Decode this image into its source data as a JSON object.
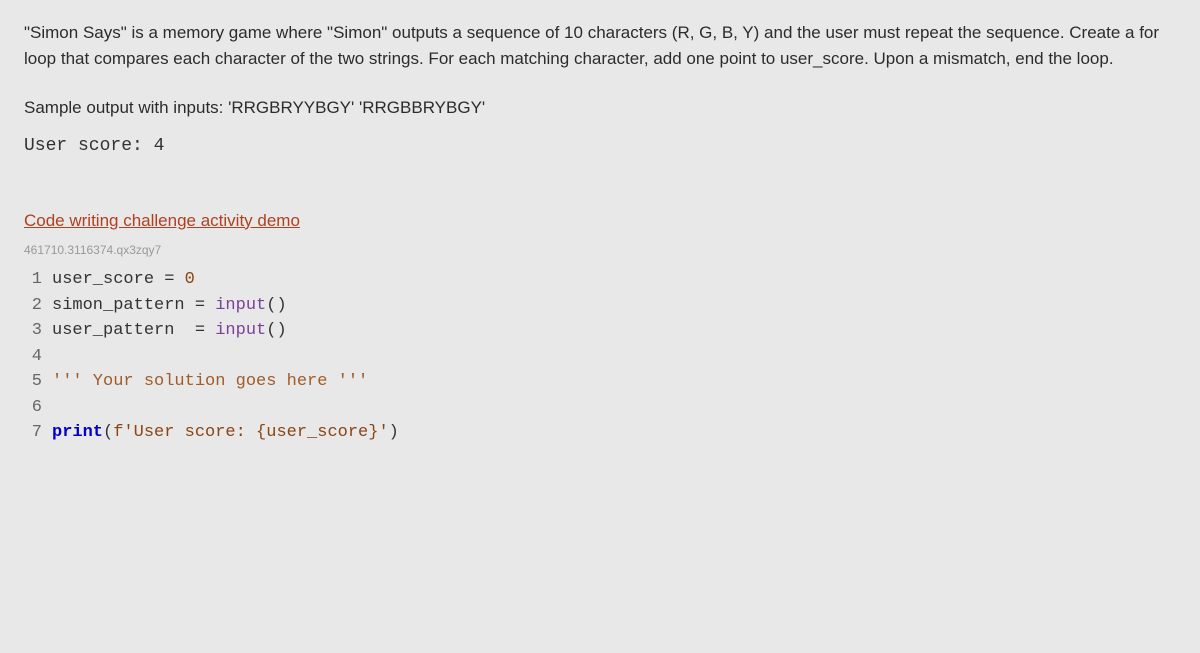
{
  "problem": {
    "description": "\"Simon Says\" is a memory game where \"Simon\" outputs a sequence of 10 characters (R, G, B, Y) and the user must repeat the sequence. Create a for loop that compares each character of the two strings. For each matching character, add one point to user_score. Upon a mismatch, end the loop.",
    "sample_label": "Sample output with inputs: 'RRGBRYYBGY' 'RRGBBRYBGY'",
    "sample_output": "User score: 4"
  },
  "demo_link": "Code writing challenge activity demo",
  "activity_id": "461710.3116374.qx3zqy7",
  "code": {
    "lines": [
      {
        "num": "1",
        "text": "user_score = 0"
      },
      {
        "num": "2",
        "text": "simon_pattern = input()"
      },
      {
        "num": "3",
        "text": "user_pattern  = input()"
      },
      {
        "num": "4",
        "text": ""
      },
      {
        "num": "5",
        "text": "''' Your solution goes here '''"
      },
      {
        "num": "6",
        "text": ""
      },
      {
        "num": "7",
        "text": "print(f'User score: {user_score}')"
      }
    ]
  }
}
